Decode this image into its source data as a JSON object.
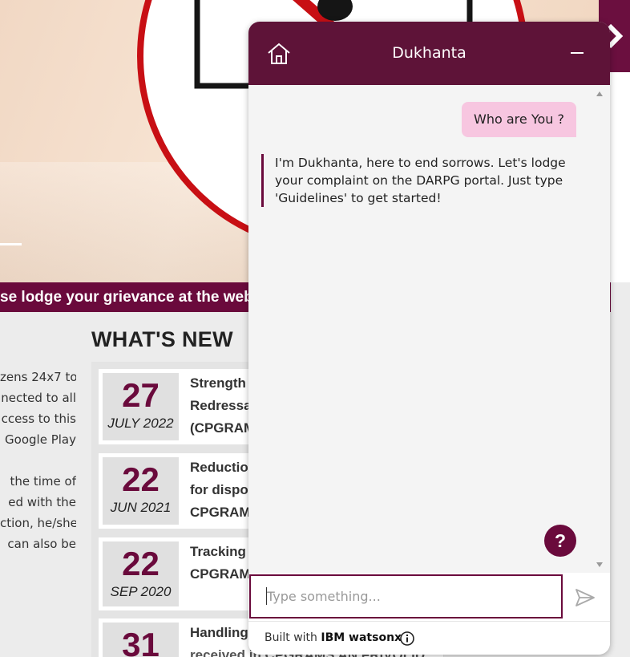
{
  "background": {
    "banner_text": "se lodge your grievance at the web",
    "left_text_lines": [
      "zens 24x7 to",
      "nected to all",
      "ccess to this",
      "Google Play",
      "",
      "the time of",
      "ed with the",
      "ction, he/she",
      "can also be"
    ],
    "whats_new": {
      "title": "WHAT'S NEW",
      "items": [
        {
          "day": "27",
          "month": "JULY 2022",
          "lines": [
            "Strength",
            "Redressa",
            "(CPGRAM"
          ]
        },
        {
          "day": "22",
          "month": "JUN 2021",
          "lines": [
            "Reductio",
            "for dispo",
            "CPGRAM"
          ]
        },
        {
          "day": "22",
          "month": "SEP 2020",
          "lines": [
            "Tracking",
            "CPGRAM"
          ]
        },
        {
          "day": "31",
          "month": "",
          "lines": [
            "Handling",
            "received in CPGRAMS AN FRIVOLID"
          ]
        }
      ]
    }
  },
  "chat": {
    "title": "Dukhanta",
    "user_message": "Who are You ?",
    "bot_message": "I'm Dukhanta, here to end sorrows. Let's lodge your complaint on the DARPG portal. Just type 'Guidelines' to get started!",
    "help_label": "?",
    "input_placeholder": "Type something...",
    "footer_prefix": "Built with ",
    "footer_brand": "IBM watsonx"
  },
  "colors": {
    "brand": "#6a0a3c",
    "header": "#5e1338",
    "user_bubble": "#f7c6e0"
  },
  "icons": [
    "home-icon",
    "minimize-icon",
    "send-icon",
    "info-icon",
    "chevron-right-icon",
    "help-icon"
  ]
}
